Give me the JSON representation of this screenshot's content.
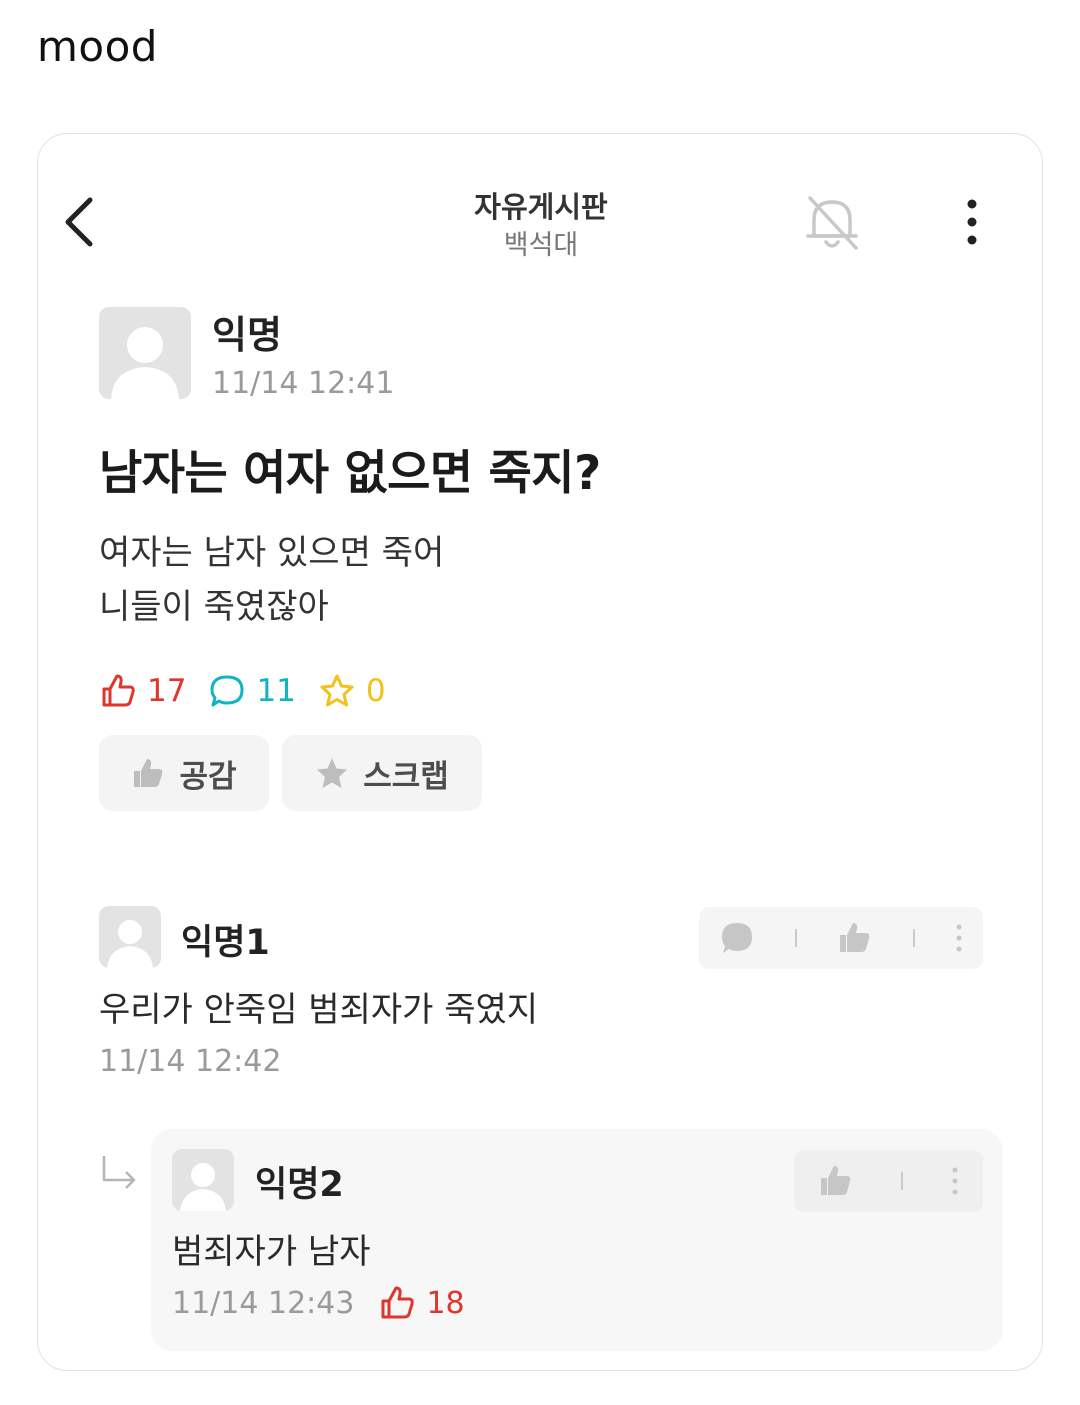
{
  "caption": "mood",
  "header": {
    "board_title": "자유게시판",
    "school": "백석대",
    "icons": [
      "back-icon",
      "bell-off-icon",
      "more-vertical-icon"
    ]
  },
  "post": {
    "author": "익명",
    "time": "11/14 12:41",
    "title": "남자는 여자 없으면 죽지?",
    "body_line1": "여자는 남자 있으면 죽어",
    "body_line2": "니들이 죽였잖아",
    "likes": "17",
    "comments": "11",
    "scraps": "0",
    "like_button": "공감",
    "scrap_button": "스크랩"
  },
  "comment": {
    "author": "익명1",
    "body": "우리가 안죽임 범죄자가 죽였지",
    "time": "11/14 12:42"
  },
  "reply": {
    "author": "익명2",
    "body": "범죄자가 남자",
    "time": "11/14 12:43",
    "likes": "18"
  },
  "colors": {
    "like": "#e0352b",
    "comment": "#10b4c4",
    "scrap": "#f1c21b"
  }
}
